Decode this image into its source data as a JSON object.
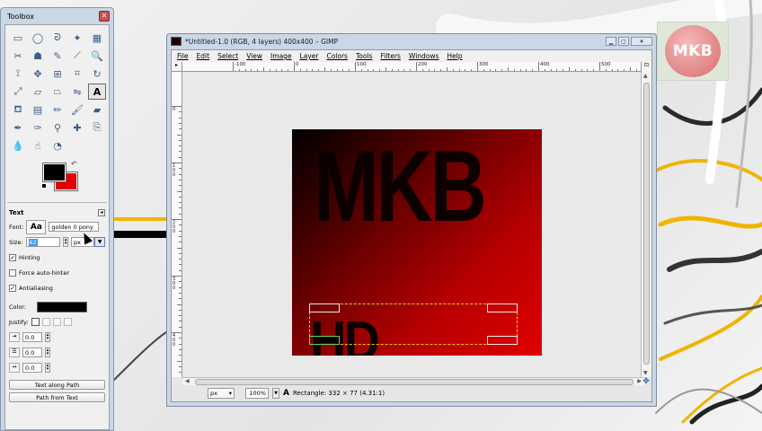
{
  "desktop": {
    "logo_text": "MKB"
  },
  "toolbox": {
    "title": "Toolbox",
    "close_glyph": "✕",
    "tools": [
      {
        "icon": "rect-select-icon",
        "glyph": "▭"
      },
      {
        "icon": "ellipse-select-icon",
        "glyph": "◯"
      },
      {
        "icon": "free-select-icon",
        "glyph": "ᘐ"
      },
      {
        "icon": "fuzzy-select-icon",
        "glyph": "✦"
      },
      {
        "icon": "color-select-icon",
        "glyph": "▦"
      },
      {
        "icon": "scissors-icon",
        "glyph": "✂"
      },
      {
        "icon": "foreground-select-icon",
        "glyph": "☗"
      },
      {
        "icon": "paths-icon",
        "glyph": "✎"
      },
      {
        "icon": "color-picker-icon",
        "glyph": "⟋"
      },
      {
        "icon": "zoom-icon",
        "glyph": "🔍"
      },
      {
        "icon": "measure-icon",
        "glyph": "⟟"
      },
      {
        "icon": "move-icon",
        "glyph": "✥"
      },
      {
        "icon": "align-icon",
        "glyph": "⊞"
      },
      {
        "icon": "crop-icon",
        "glyph": "⌗"
      },
      {
        "icon": "rotate-icon",
        "glyph": "↻"
      },
      {
        "icon": "scale-icon",
        "glyph": "⤢"
      },
      {
        "icon": "shear-icon",
        "glyph": "▱"
      },
      {
        "icon": "perspective-icon",
        "glyph": "⏢"
      },
      {
        "icon": "flip-icon",
        "glyph": "⇋"
      },
      {
        "icon": "text-tool-icon",
        "glyph": "A"
      },
      {
        "icon": "bucket-fill-icon",
        "glyph": "⛾"
      },
      {
        "icon": "blend-icon",
        "glyph": "▤"
      },
      {
        "icon": "pencil-icon",
        "glyph": "✏"
      },
      {
        "icon": "paintbrush-icon",
        "glyph": "🖌"
      },
      {
        "icon": "eraser-icon",
        "glyph": "▰"
      },
      {
        "icon": "airbrush-icon",
        "glyph": "✒"
      },
      {
        "icon": "ink-icon",
        "glyph": "✑"
      },
      {
        "icon": "clone-icon",
        "glyph": "⚲"
      },
      {
        "icon": "heal-icon",
        "glyph": "✚"
      },
      {
        "icon": "perspective-clone-icon",
        "glyph": "⎘"
      },
      {
        "icon": "blur-icon",
        "glyph": "💧"
      },
      {
        "icon": "smudge-icon",
        "glyph": "☝"
      },
      {
        "icon": "dodge-burn-icon",
        "glyph": "◔"
      }
    ],
    "swap_glyph": "↶",
    "options": {
      "heading": "Text",
      "dock_glyph": "◂",
      "font_label": "Font:",
      "font_preview": "Aa",
      "font_value": "golden 0 pony",
      "size_label": "Size:",
      "size_value": "62",
      "unit_value": "px",
      "dropdown_glyph": "▼",
      "hinting_label": "Hinting",
      "hinting_checked": "✓",
      "force_autohinter_label": "Force auto-hinter",
      "antialiasing_label": "Antialiasing",
      "antialiasing_checked": "✓",
      "color_label": "Color:",
      "justify_label": "Justify:",
      "indent_value": "0.0",
      "line_spacing_value": "0.0",
      "letter_spacing_value": "0.0",
      "text_along_path_label": "Text along Path",
      "path_from_text_label": "Path from Text"
    }
  },
  "image_window": {
    "title": "*Untitled-1.0 (RGB, 4 layers) 400x400 – GIMP",
    "menu": [
      "File",
      "Edit",
      "Select",
      "View",
      "Image",
      "Layer",
      "Colors",
      "Tools",
      "Filters",
      "Windows",
      "Help"
    ],
    "hruler_labels": [
      "-100",
      "0",
      "100",
      "200",
      "300",
      "400",
      "500"
    ],
    "vruler_labels": [
      "0",
      "100",
      "200",
      "300",
      "400"
    ],
    "canvas_text_top": "MKB",
    "canvas_text_bottom": "HD",
    "status": {
      "unit": "px",
      "zoom": "100%",
      "message": "Rectangle: 332 × 77  (4.31:1)"
    }
  }
}
